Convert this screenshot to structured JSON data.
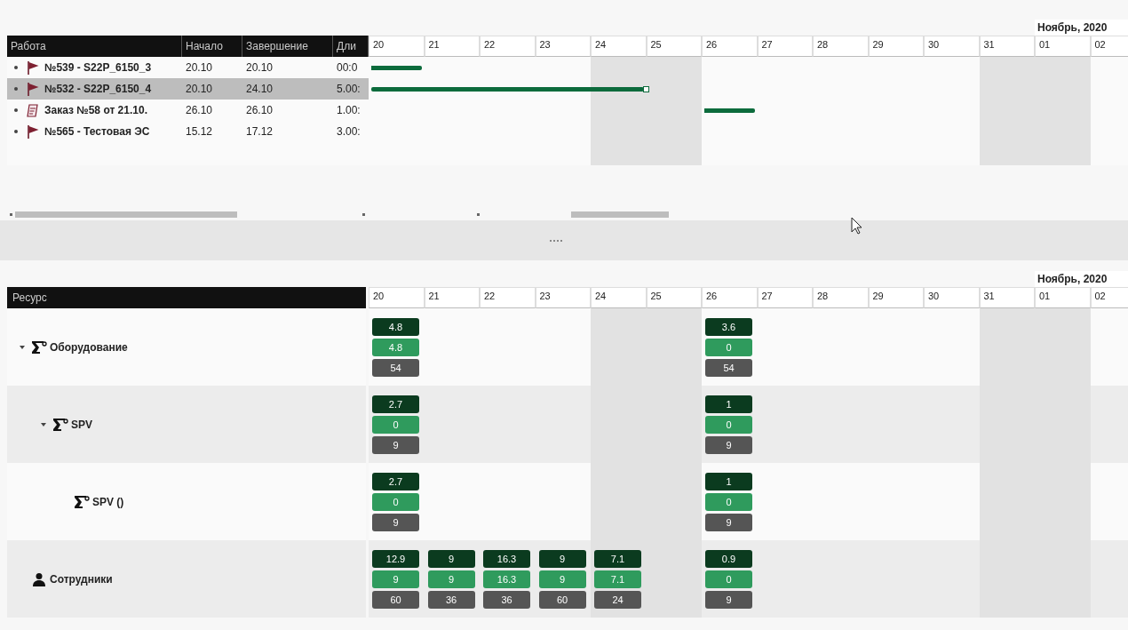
{
  "gantt": {
    "month_label": "Ноябрь, 2020",
    "columns": [
      "Работа",
      "Начало",
      "Завершение",
      "Дли"
    ],
    "days": [
      {
        "label": "20",
        "weekend": false
      },
      {
        "label": "21",
        "weekend": false
      },
      {
        "label": "22",
        "weekend": false
      },
      {
        "label": "23",
        "weekend": false
      },
      {
        "label": "24",
        "weekend": true
      },
      {
        "label": "25",
        "weekend": true
      },
      {
        "label": "26",
        "weekend": false
      },
      {
        "label": "27",
        "weekend": false
      },
      {
        "label": "28",
        "weekend": false
      },
      {
        "label": "29",
        "weekend": false
      },
      {
        "label": "30",
        "weekend": false
      },
      {
        "label": "31",
        "weekend": true
      },
      {
        "label": "01",
        "weekend": true
      },
      {
        "label": "02",
        "weekend": false
      }
    ],
    "tasks": [
      {
        "kind": "flag",
        "name": "№539 - S22P_6150_3",
        "start": "20.10",
        "end": "20.10",
        "duration": "00:0",
        "selected": false,
        "bar_days": [
          true,
          false,
          false,
          false,
          false,
          false,
          false,
          false,
          false,
          false,
          false,
          false,
          false,
          false
        ]
      },
      {
        "kind": "flag",
        "name": "№532 - S22P_6150_4",
        "start": "20.10",
        "end": "24.10",
        "duration": "5.00:",
        "selected": true,
        "bar_days": [
          true,
          true,
          true,
          true,
          true,
          false,
          false,
          false,
          false,
          false,
          false,
          false,
          false,
          false
        ],
        "end_marker": true
      },
      {
        "kind": "order",
        "name": "Заказ №58 от 21.10.",
        "start": "26.10",
        "end": "26.10",
        "duration": "1.00:",
        "selected": false,
        "bar_days": [
          false,
          false,
          false,
          false,
          false,
          false,
          true,
          false,
          false,
          false,
          false,
          false,
          false,
          false
        ]
      },
      {
        "kind": "flag",
        "name": "№565 - Тестовая ЭС",
        "start": "15.12",
        "end": "17.12",
        "duration": "3.00:",
        "selected": false
      }
    ]
  },
  "resources": {
    "month_label": "Ноябрь, 2020",
    "column": "Ресурс",
    "days": [
      {
        "label": "20",
        "weekend": false
      },
      {
        "label": "21",
        "weekend": false
      },
      {
        "label": "22",
        "weekend": false
      },
      {
        "label": "23",
        "weekend": false
      },
      {
        "label": "24",
        "weekend": true
      },
      {
        "label": "25",
        "weekend": true
      },
      {
        "label": "26",
        "weekend": false
      },
      {
        "label": "27",
        "weekend": false
      },
      {
        "label": "28",
        "weekend": false
      },
      {
        "label": "29",
        "weekend": false
      },
      {
        "label": "30",
        "weekend": false
      },
      {
        "label": "31",
        "weekend": true
      },
      {
        "label": "01",
        "weekend": true
      },
      {
        "label": "02",
        "weekend": false
      }
    ],
    "items": [
      {
        "kind": "equipment",
        "name": "Оборудование",
        "expanded": true,
        "cells": [
          [
            "4.8",
            "4.8",
            "54"
          ],
          null,
          null,
          null,
          null,
          null,
          [
            "3.6",
            "0",
            "54"
          ],
          null,
          null,
          null,
          null,
          null,
          null,
          null
        ],
        "children": [
          {
            "kind": "equipment",
            "name": "SPV",
            "expanded": true,
            "cells": [
              [
                "2.7",
                "0",
                "9"
              ],
              null,
              null,
              null,
              null,
              null,
              [
                "1",
                "0",
                "9"
              ],
              null,
              null,
              null,
              null,
              null,
              null,
              null
            ],
            "children": [
              {
                "kind": "equipment",
                "name": "SPV ()",
                "cells": [
                  [
                    "2.7",
                    "0",
                    "9"
                  ],
                  null,
                  null,
                  null,
                  null,
                  null,
                  [
                    "1",
                    "0",
                    "9"
                  ],
                  null,
                  null,
                  null,
                  null,
                  null,
                  null,
                  null
                ]
              }
            ]
          }
        ]
      },
      {
        "kind": "person",
        "name": "Сотрудники",
        "cells": [
          [
            "12.9",
            "9",
            "60"
          ],
          [
            "9",
            "9",
            "36"
          ],
          [
            "16.3",
            "16.3",
            "36"
          ],
          [
            "9",
            "9",
            "60"
          ],
          [
            "7.1",
            "7.1",
            "24"
          ],
          null,
          [
            "0.9",
            "0",
            "9"
          ],
          null,
          null,
          null,
          null,
          null,
          null,
          null
        ]
      }
    ]
  }
}
